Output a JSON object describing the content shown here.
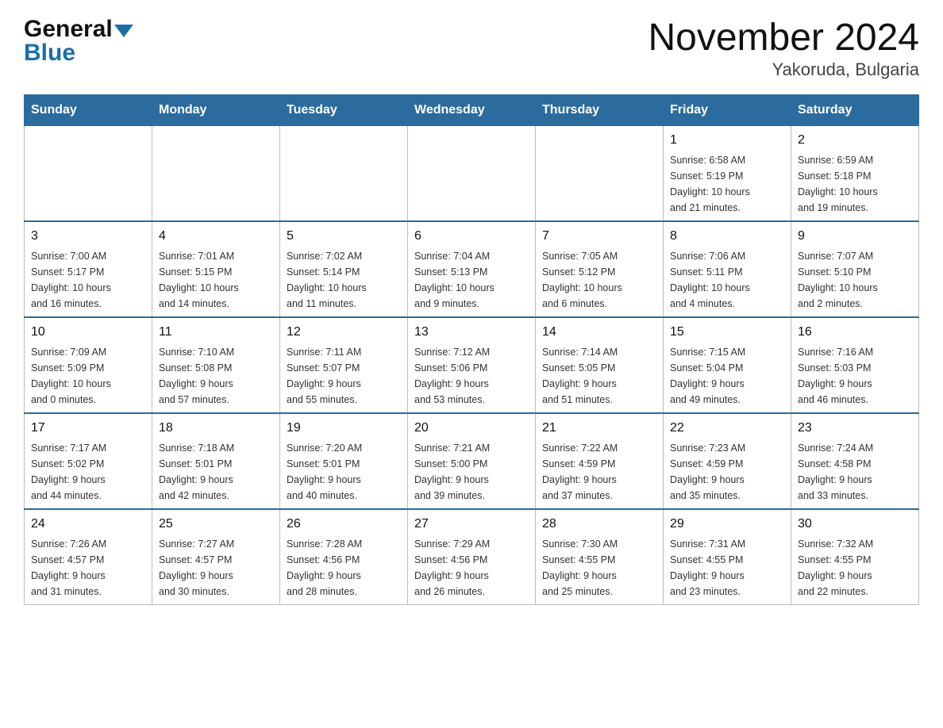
{
  "header": {
    "logo_general": "General",
    "logo_blue": "Blue",
    "title": "November 2024",
    "subtitle": "Yakoruda, Bulgaria"
  },
  "days_of_week": [
    "Sunday",
    "Monday",
    "Tuesday",
    "Wednesday",
    "Thursday",
    "Friday",
    "Saturday"
  ],
  "weeks": [
    [
      {
        "day": "",
        "info": ""
      },
      {
        "day": "",
        "info": ""
      },
      {
        "day": "",
        "info": ""
      },
      {
        "day": "",
        "info": ""
      },
      {
        "day": "",
        "info": ""
      },
      {
        "day": "1",
        "info": "Sunrise: 6:58 AM\nSunset: 5:19 PM\nDaylight: 10 hours\nand 21 minutes."
      },
      {
        "day": "2",
        "info": "Sunrise: 6:59 AM\nSunset: 5:18 PM\nDaylight: 10 hours\nand 19 minutes."
      }
    ],
    [
      {
        "day": "3",
        "info": "Sunrise: 7:00 AM\nSunset: 5:17 PM\nDaylight: 10 hours\nand 16 minutes."
      },
      {
        "day": "4",
        "info": "Sunrise: 7:01 AM\nSunset: 5:15 PM\nDaylight: 10 hours\nand 14 minutes."
      },
      {
        "day": "5",
        "info": "Sunrise: 7:02 AM\nSunset: 5:14 PM\nDaylight: 10 hours\nand 11 minutes."
      },
      {
        "day": "6",
        "info": "Sunrise: 7:04 AM\nSunset: 5:13 PM\nDaylight: 10 hours\nand 9 minutes."
      },
      {
        "day": "7",
        "info": "Sunrise: 7:05 AM\nSunset: 5:12 PM\nDaylight: 10 hours\nand 6 minutes."
      },
      {
        "day": "8",
        "info": "Sunrise: 7:06 AM\nSunset: 5:11 PM\nDaylight: 10 hours\nand 4 minutes."
      },
      {
        "day": "9",
        "info": "Sunrise: 7:07 AM\nSunset: 5:10 PM\nDaylight: 10 hours\nand 2 minutes."
      }
    ],
    [
      {
        "day": "10",
        "info": "Sunrise: 7:09 AM\nSunset: 5:09 PM\nDaylight: 10 hours\nand 0 minutes."
      },
      {
        "day": "11",
        "info": "Sunrise: 7:10 AM\nSunset: 5:08 PM\nDaylight: 9 hours\nand 57 minutes."
      },
      {
        "day": "12",
        "info": "Sunrise: 7:11 AM\nSunset: 5:07 PM\nDaylight: 9 hours\nand 55 minutes."
      },
      {
        "day": "13",
        "info": "Sunrise: 7:12 AM\nSunset: 5:06 PM\nDaylight: 9 hours\nand 53 minutes."
      },
      {
        "day": "14",
        "info": "Sunrise: 7:14 AM\nSunset: 5:05 PM\nDaylight: 9 hours\nand 51 minutes."
      },
      {
        "day": "15",
        "info": "Sunrise: 7:15 AM\nSunset: 5:04 PM\nDaylight: 9 hours\nand 49 minutes."
      },
      {
        "day": "16",
        "info": "Sunrise: 7:16 AM\nSunset: 5:03 PM\nDaylight: 9 hours\nand 46 minutes."
      }
    ],
    [
      {
        "day": "17",
        "info": "Sunrise: 7:17 AM\nSunset: 5:02 PM\nDaylight: 9 hours\nand 44 minutes."
      },
      {
        "day": "18",
        "info": "Sunrise: 7:18 AM\nSunset: 5:01 PM\nDaylight: 9 hours\nand 42 minutes."
      },
      {
        "day": "19",
        "info": "Sunrise: 7:20 AM\nSunset: 5:01 PM\nDaylight: 9 hours\nand 40 minutes."
      },
      {
        "day": "20",
        "info": "Sunrise: 7:21 AM\nSunset: 5:00 PM\nDaylight: 9 hours\nand 39 minutes."
      },
      {
        "day": "21",
        "info": "Sunrise: 7:22 AM\nSunset: 4:59 PM\nDaylight: 9 hours\nand 37 minutes."
      },
      {
        "day": "22",
        "info": "Sunrise: 7:23 AM\nSunset: 4:59 PM\nDaylight: 9 hours\nand 35 minutes."
      },
      {
        "day": "23",
        "info": "Sunrise: 7:24 AM\nSunset: 4:58 PM\nDaylight: 9 hours\nand 33 minutes."
      }
    ],
    [
      {
        "day": "24",
        "info": "Sunrise: 7:26 AM\nSunset: 4:57 PM\nDaylight: 9 hours\nand 31 minutes."
      },
      {
        "day": "25",
        "info": "Sunrise: 7:27 AM\nSunset: 4:57 PM\nDaylight: 9 hours\nand 30 minutes."
      },
      {
        "day": "26",
        "info": "Sunrise: 7:28 AM\nSunset: 4:56 PM\nDaylight: 9 hours\nand 28 minutes."
      },
      {
        "day": "27",
        "info": "Sunrise: 7:29 AM\nSunset: 4:56 PM\nDaylight: 9 hours\nand 26 minutes."
      },
      {
        "day": "28",
        "info": "Sunrise: 7:30 AM\nSunset: 4:55 PM\nDaylight: 9 hours\nand 25 minutes."
      },
      {
        "day": "29",
        "info": "Sunrise: 7:31 AM\nSunset: 4:55 PM\nDaylight: 9 hours\nand 23 minutes."
      },
      {
        "day": "30",
        "info": "Sunrise: 7:32 AM\nSunset: 4:55 PM\nDaylight: 9 hours\nand 22 minutes."
      }
    ]
  ]
}
